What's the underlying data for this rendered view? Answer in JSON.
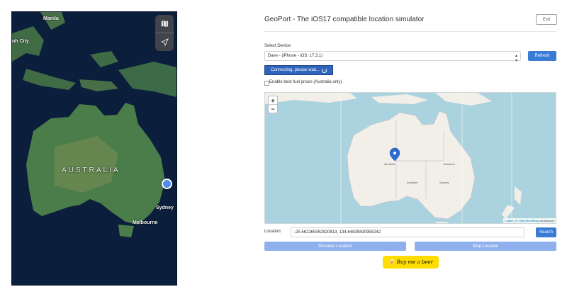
{
  "phone_map": {
    "places": {
      "manila": "Manila",
      "ho_chi_minh": "nh City",
      "country": "AUSTRALIA",
      "sydney": "Sydney",
      "melbourne": "Melbourne"
    },
    "controls": [
      "map-icon",
      "location-arrow-icon"
    ],
    "colors": {
      "ocean": "#0b1e3b",
      "land": "#4a7d4a",
      "desert": "#6f8a52",
      "user_dot": "#4b8df2"
    }
  },
  "app": {
    "title": "GeoPort - The iOS17 compatible location simulator",
    "exit_label": "Exit",
    "select_device_label": "Select Device:",
    "device_value": "Dave - (iPhone - iOS: 17.3.1)",
    "refresh_label": "Refresh",
    "connecting_label": "Connecting, please wait...",
    "fuel_checkbox_label": "Enable best fuel prices (Australia only)",
    "location_label": "Location:",
    "location_value": "-25.562265062820813, 134.64835830958242",
    "search_label": "Search",
    "simulate_label": "Simulate Location",
    "stop_label": "Stop Location",
    "bmc_label": "Buy me a beer",
    "accent_color": "#3a7bd5"
  },
  "map_widget": {
    "zoom_in": "+",
    "zoom_out": "−",
    "attribution_leaflet": "Leaflet",
    "attribution_sep": "| ©",
    "attribution_osm": "OpenStreetMap",
    "attribution_tail": "contributors",
    "labels": {
      "alice": "Ali Wells",
      "brisbane": "Brisbane",
      "sydney": "Sydney",
      "adelaide": "Adelaide"
    },
    "marker_coords": "-25.562265062820813, 134.64835830958242"
  }
}
